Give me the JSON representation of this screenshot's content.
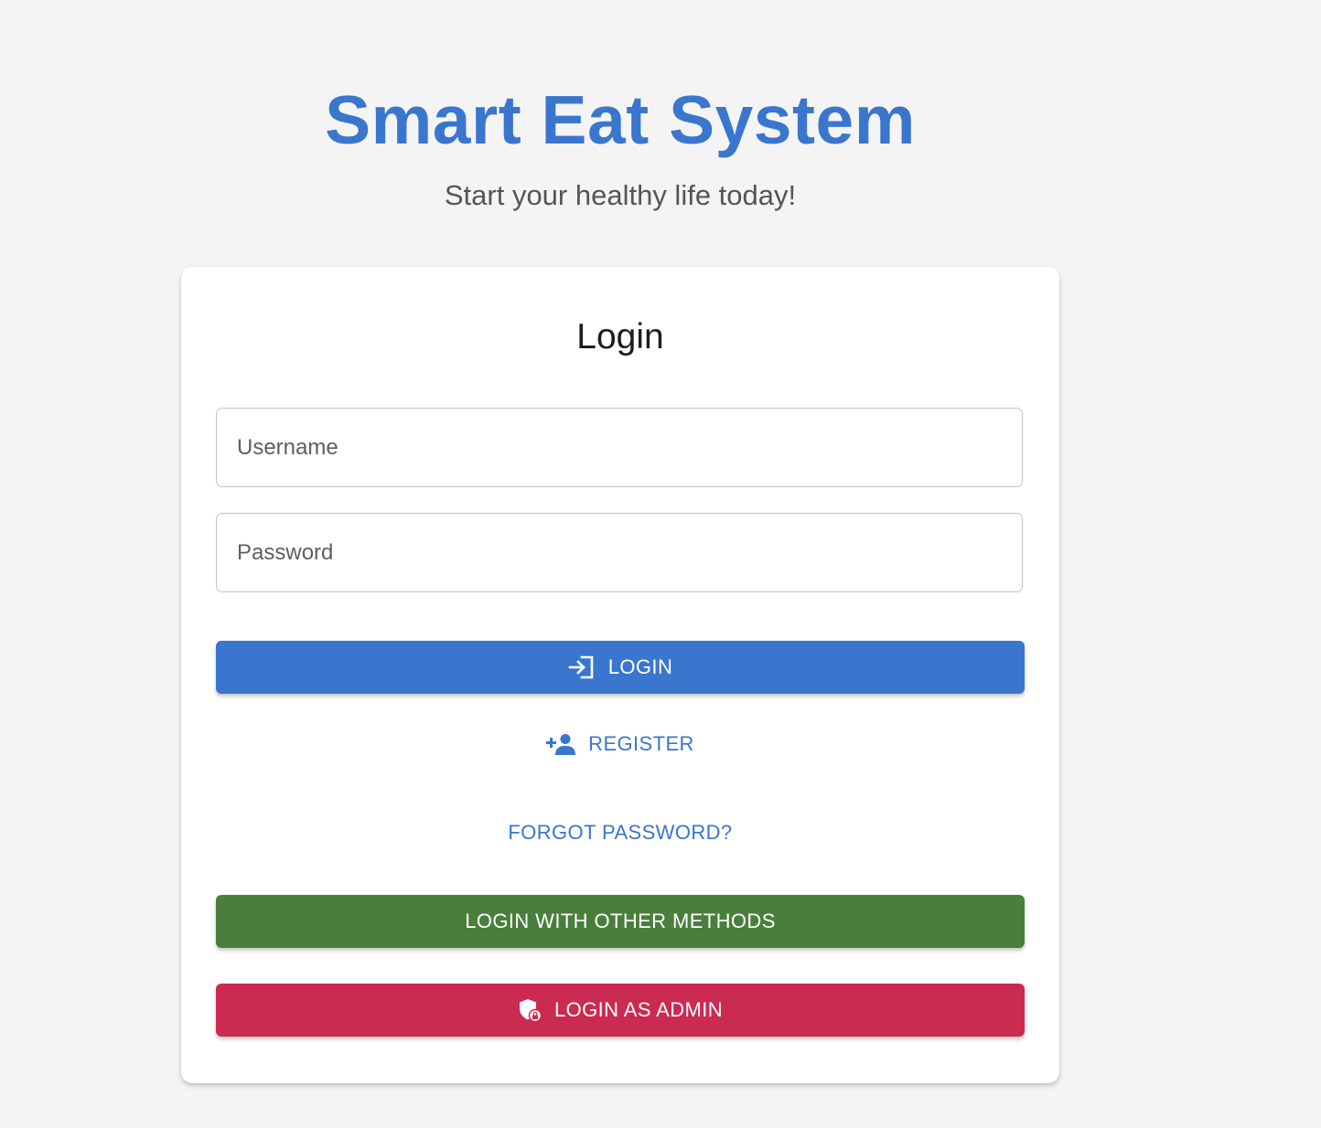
{
  "header": {
    "title": "Smart Eat System",
    "subtitle": "Start your healthy life today!"
  },
  "login_card": {
    "title": "Login",
    "username_placeholder": "Username",
    "password_placeholder": "Password",
    "login_button": "LOGIN",
    "register_button": "REGISTER",
    "forgot_password_button": "FORGOT PASSWORD?",
    "other_methods_button": "LOGIN WITH OTHER METHODS",
    "admin_button": "LOGIN AS ADMIN"
  },
  "icons": {
    "login": "login-icon",
    "register": "person-add-icon",
    "admin": "admin-shield-icon"
  },
  "colors": {
    "primary": "#3a76cd",
    "success": "#4a7e3c",
    "danger": "#cb2a51",
    "background": "#f4f4f4"
  }
}
